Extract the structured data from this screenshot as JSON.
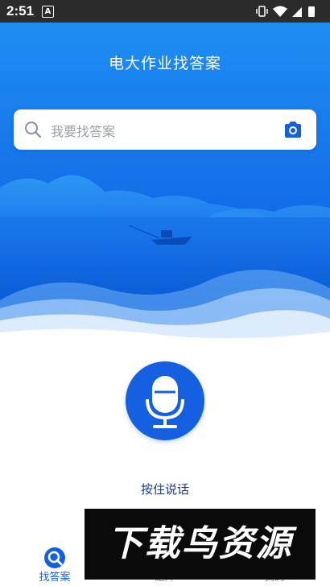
{
  "status_bar": {
    "time": "2:51",
    "notif_icon": "A"
  },
  "app": {
    "title": "电大作业找答案"
  },
  "search": {
    "placeholder": "我要找答案",
    "icon": "search-icon",
    "camera": "camera-icon"
  },
  "voice": {
    "label": "按住说话",
    "icon": "microphone-icon"
  },
  "tabs": [
    {
      "label": "找答案",
      "icon": "search-icon",
      "active": true
    },
    {
      "label": "题库",
      "icon": "book-icon",
      "active": false
    },
    {
      "label": "我的",
      "icon": "user-icon",
      "active": false
    }
  ],
  "watermark": {
    "text": "下载鸟资源"
  },
  "colors": {
    "primary": "#1560e0",
    "hero_top": "#1f8ef1",
    "hero_bottom": "#0b5fe0"
  }
}
